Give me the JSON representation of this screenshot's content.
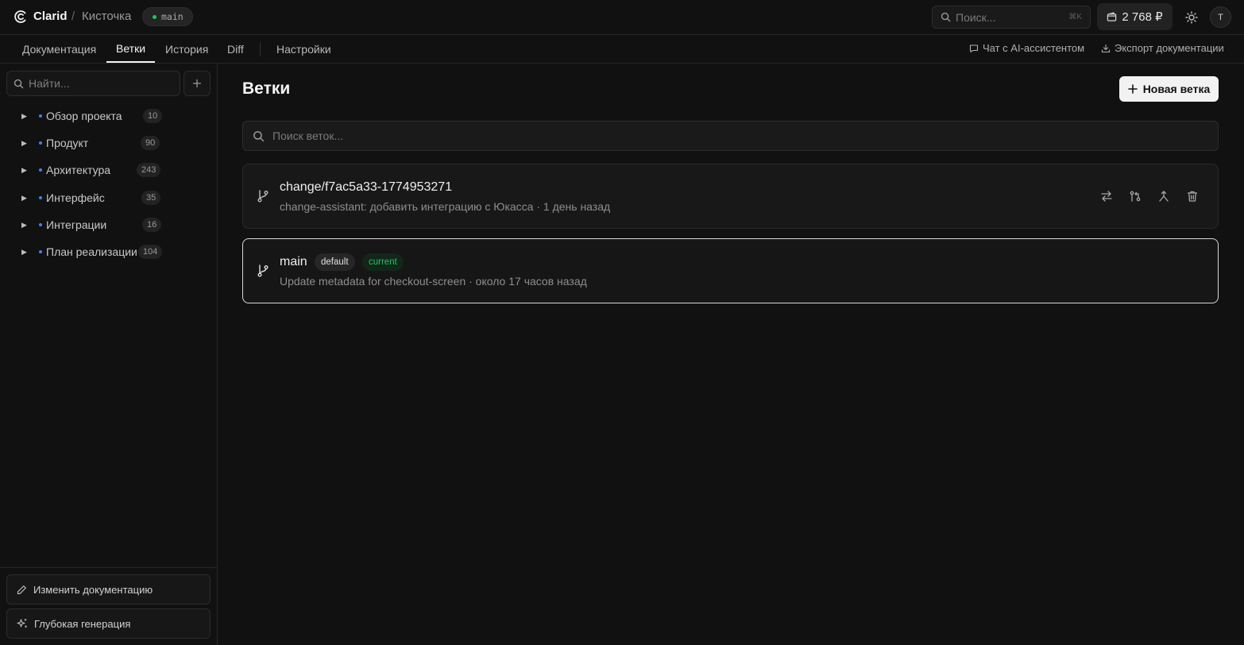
{
  "header": {
    "brand": "Clarid",
    "separator": "/",
    "project": "Кисточка",
    "branch": "main",
    "search_placeholder": "Поиск...",
    "search_shortcut": "⌘K",
    "balance": "2 768 ₽",
    "avatar_initial": "T"
  },
  "tabs": [
    {
      "label": "Документация"
    },
    {
      "label": "Ветки"
    },
    {
      "label": "История"
    },
    {
      "label": "Diff"
    },
    {
      "label": "Настройки"
    }
  ],
  "tab_actions": {
    "chat": "Чат с AI-ассистентом",
    "export": "Экспорт документации"
  },
  "sidebar": {
    "search_placeholder": "Найти...",
    "items": [
      {
        "label": "Обзор проекта",
        "count": "10"
      },
      {
        "label": "Продукт",
        "count": "90"
      },
      {
        "label": "Архитектура",
        "count": "243"
      },
      {
        "label": "Интерфейс",
        "count": "35"
      },
      {
        "label": "Интеграции",
        "count": "16"
      },
      {
        "label": "План реализации",
        "count": "104"
      }
    ],
    "footer": {
      "edit_docs": "Изменить документацию",
      "deep_generation": "Глубокая генерация"
    }
  },
  "main": {
    "title": "Ветки",
    "new_branch": "Новая ветка",
    "search_placeholder": "Поиск веток...",
    "branches": [
      {
        "name": "change/f7ac5a33-1774953271",
        "meta": "change-assistant: добавить интеграцию с Юкасса · 1 день назад"
      },
      {
        "name": "main",
        "badge_default": "default",
        "badge_current": "current",
        "meta": "Update metadata for checkout-screen · около 17 часов назад"
      }
    ]
  },
  "colors": {
    "background": "#111111",
    "accent_green": "#22c55e",
    "tree_dot_blue": "#3b82f6",
    "primary_button": "#f2f2f2"
  }
}
